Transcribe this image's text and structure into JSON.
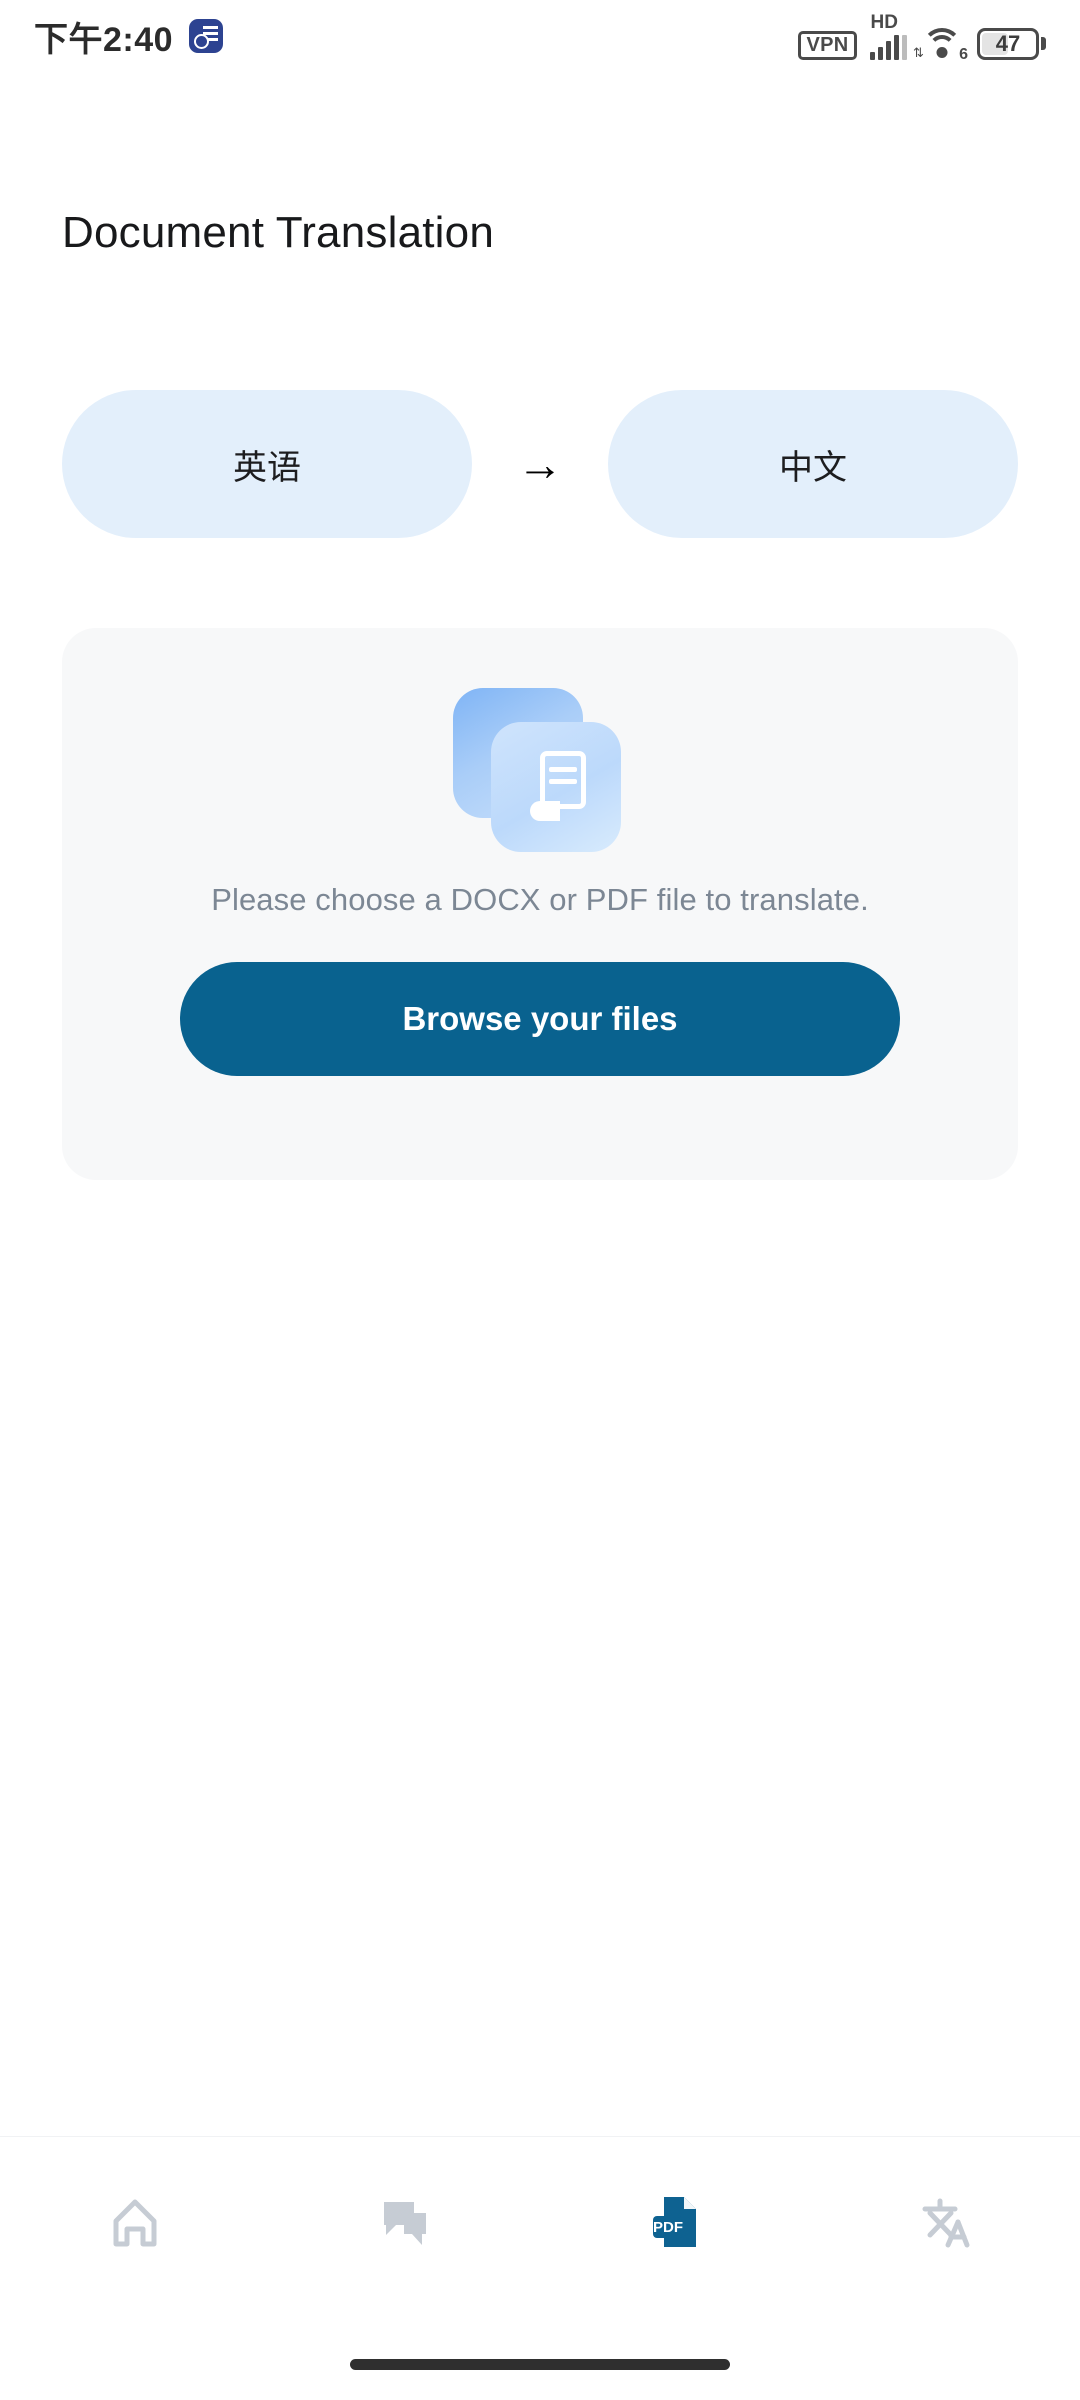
{
  "status_bar": {
    "time": "下午2:40",
    "notification_badge_icon": "document-clock-badge-icon",
    "vpn_label": "VPN",
    "network_type": "HD",
    "wifi_generation": "6",
    "battery_percent": "47"
  },
  "header": {
    "title": "Document Translation"
  },
  "language_selector": {
    "source_language": "英语",
    "arrow": "→",
    "target_language": "中文"
  },
  "upload_card": {
    "illustration_icon": "stacked-documents-icon",
    "hint": "Please choose a DOCX or PDF file to translate.",
    "browse_button_label": "Browse your files"
  },
  "bottom_nav": {
    "items": [
      {
        "name": "home",
        "icon": "home-icon",
        "active": false
      },
      {
        "name": "chat",
        "icon": "chat-bubbles-icon",
        "active": false
      },
      {
        "name": "documents",
        "icon": "pdf-file-icon",
        "active": true
      },
      {
        "name": "translate",
        "icon": "translate-icon",
        "active": false
      }
    ],
    "pdf_badge_label": "PDF"
  },
  "colors": {
    "accent": "#09628f",
    "pill_background": "#e3effb",
    "card_background": "#f7f8f9",
    "inactive_icon": "#c6ccd4",
    "hint_text": "#7c8794"
  }
}
